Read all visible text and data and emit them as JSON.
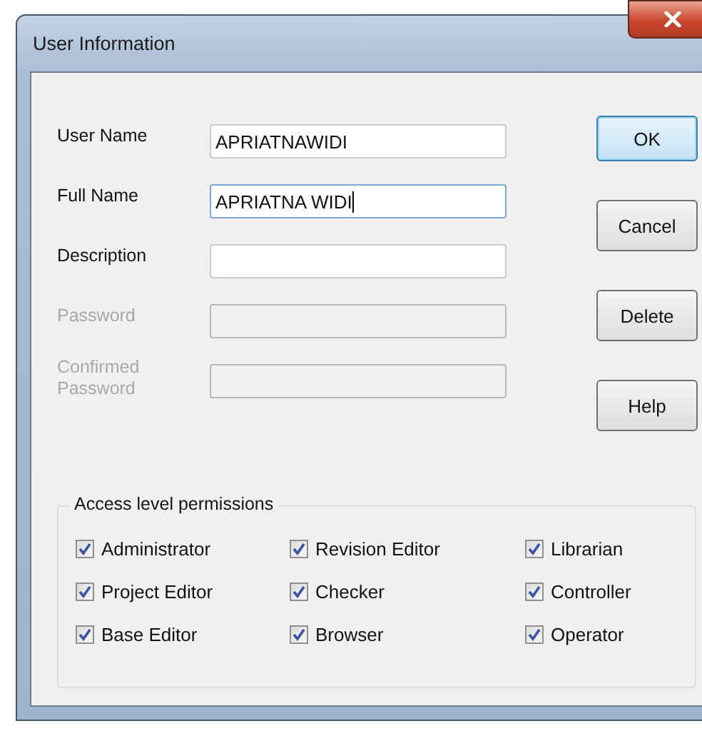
{
  "window": {
    "title": "User Information"
  },
  "fields": [
    {
      "label": "User Name",
      "value": "APRIATNAWIDI",
      "disabled": false,
      "focused": false
    },
    {
      "label": "Full Name",
      "value": "APRIATNA WIDI",
      "disabled": false,
      "focused": true
    },
    {
      "label": "Description",
      "disabled": false,
      "focused": false
    },
    {
      "label": "Password",
      "disabled": true,
      "focused": false
    },
    {
      "label": "Confirmed Password",
      "disabled": true,
      "focused": false
    }
  ],
  "buttons": [
    {
      "label": "OK",
      "default": true
    },
    {
      "label": "Cancel",
      "default": false
    },
    {
      "label": "Delete",
      "default": false
    },
    {
      "label": "Help",
      "default": false
    }
  ],
  "permissions": {
    "title": "Access level permissions",
    "items": [
      {
        "label": "Administrator",
        "checked": true
      },
      {
        "label": "Revision Editor",
        "checked": true
      },
      {
        "label": "Librarian",
        "checked": true
      },
      {
        "label": "Project Editor",
        "checked": true
      },
      {
        "label": "Checker",
        "checked": true
      },
      {
        "label": "Controller",
        "checked": true
      },
      {
        "label": "Base Editor",
        "checked": true
      },
      {
        "label": "Browser",
        "checked": true
      },
      {
        "label": "Operator",
        "checked": true
      }
    ]
  }
}
